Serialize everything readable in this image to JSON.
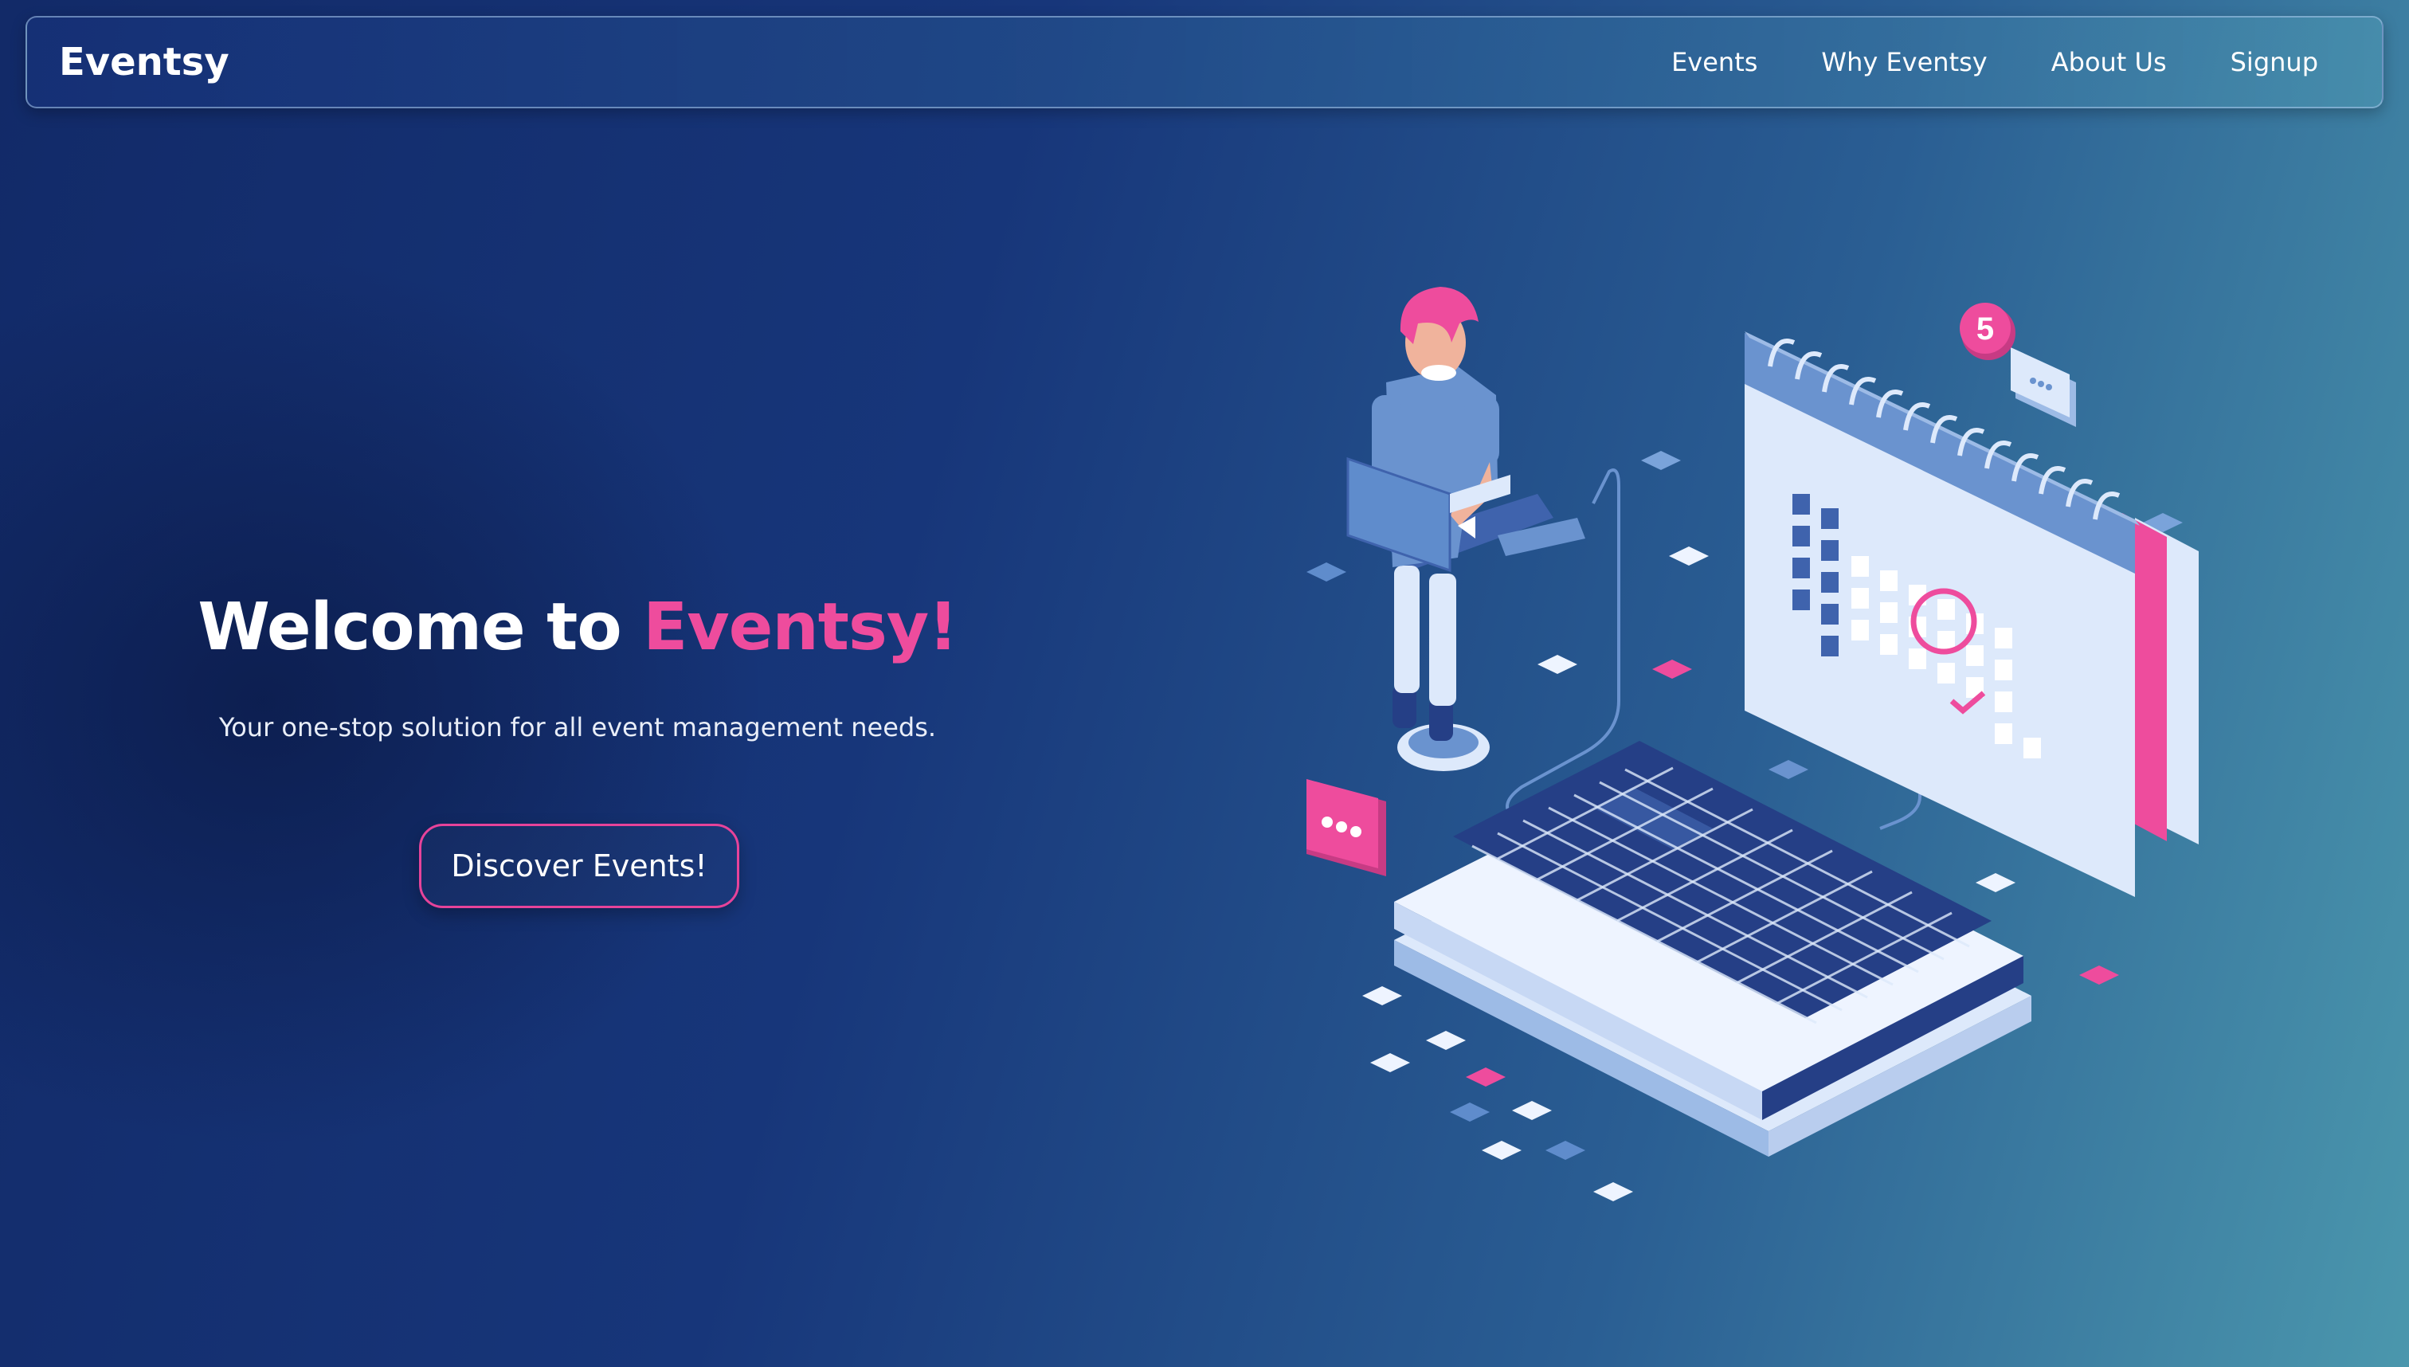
{
  "navbar": {
    "brand": "Eventsy",
    "links": [
      {
        "label": "Events"
      },
      {
        "label": "Why Eventsy"
      },
      {
        "label": "About Us"
      },
      {
        "label": "Signup"
      }
    ]
  },
  "hero": {
    "title_prefix": "Welcome to ",
    "title_accent": "Eventsy!",
    "subtitle": "Your one-stop solution for all event management needs.",
    "cta_label": "Discover Events!"
  },
  "illustration": {
    "notification_count": "5"
  },
  "colors": {
    "accent": "#ee4c9d",
    "background_dark": "#122a68",
    "background_light": "#4b97ad",
    "illustration_light": "#dde9fb",
    "illustration_mid": "#6a93cf",
    "illustration_dark": "#253f86"
  }
}
